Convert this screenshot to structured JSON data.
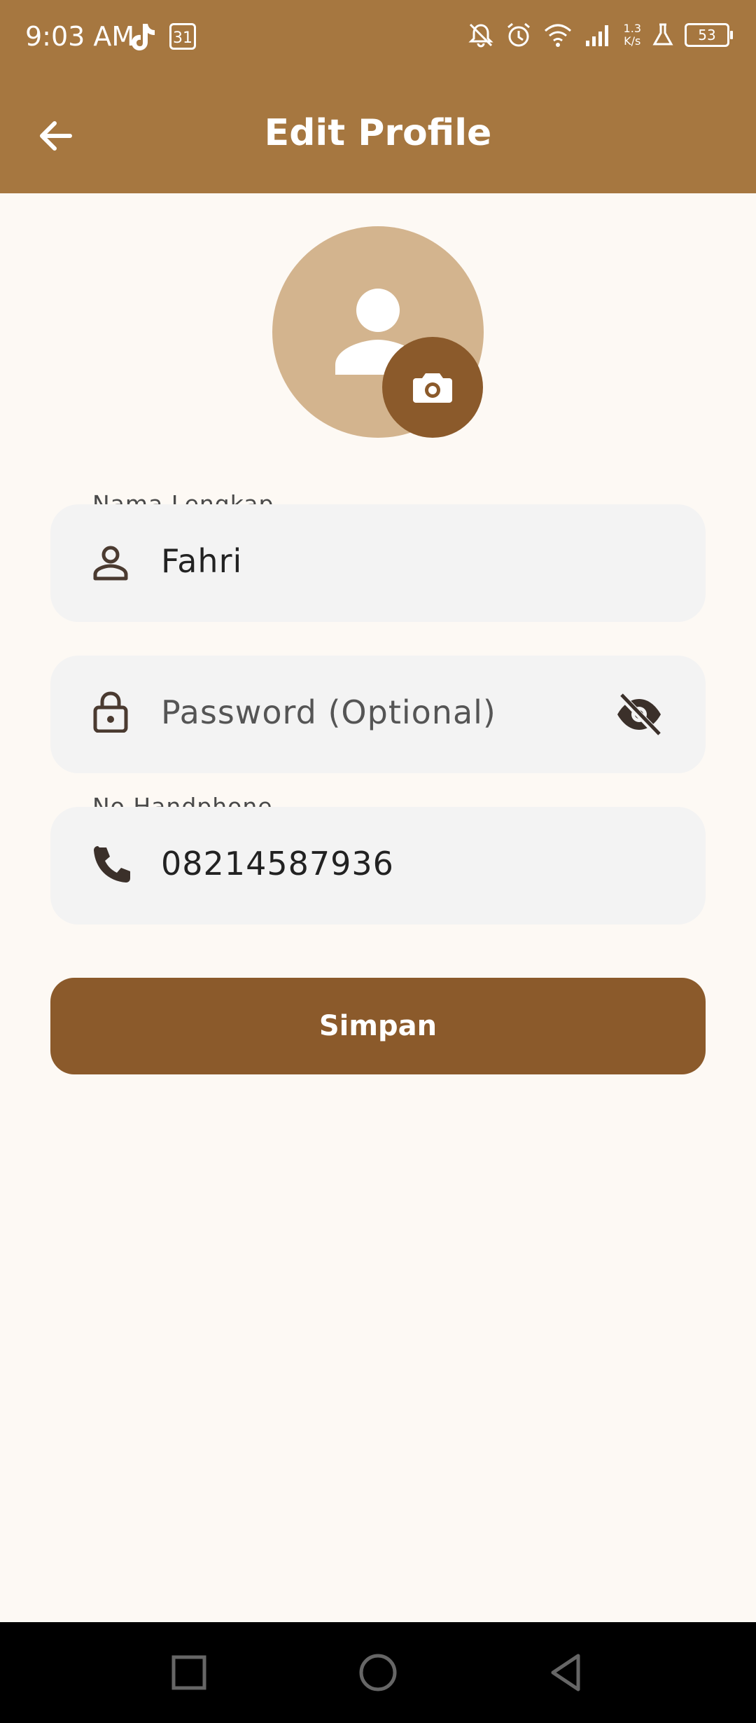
{
  "status_bar": {
    "time": "9:03 AM",
    "calendar_day": "31",
    "speed_value": "1.3",
    "speed_unit": "K/s",
    "battery": "53",
    "icons": [
      "tiktok-icon",
      "calendar-icon",
      "bell-off-icon",
      "alarm-icon",
      "wifi-icon",
      "signal-icon",
      "lab-icon",
      "battery-icon"
    ]
  },
  "app_bar": {
    "title": "Edit Profile",
    "back_icon": "arrow-left-icon"
  },
  "avatar": {
    "placeholder_icon": "person-icon",
    "camera_icon": "camera-icon"
  },
  "form": {
    "name_label": "Nama Lengkap",
    "name_value": "Fahri",
    "password_placeholder": "Password (Optional)",
    "phone_label": "No Handphone",
    "phone_value": "08214587936"
  },
  "save_button": "Simpan",
  "colors": {
    "primary": "#a67740",
    "primary_dark": "#8b5a2b",
    "avatar_bg": "#d3b48e",
    "page_bg": "#fdf9f4",
    "field_bg": "#f3f3f3"
  }
}
